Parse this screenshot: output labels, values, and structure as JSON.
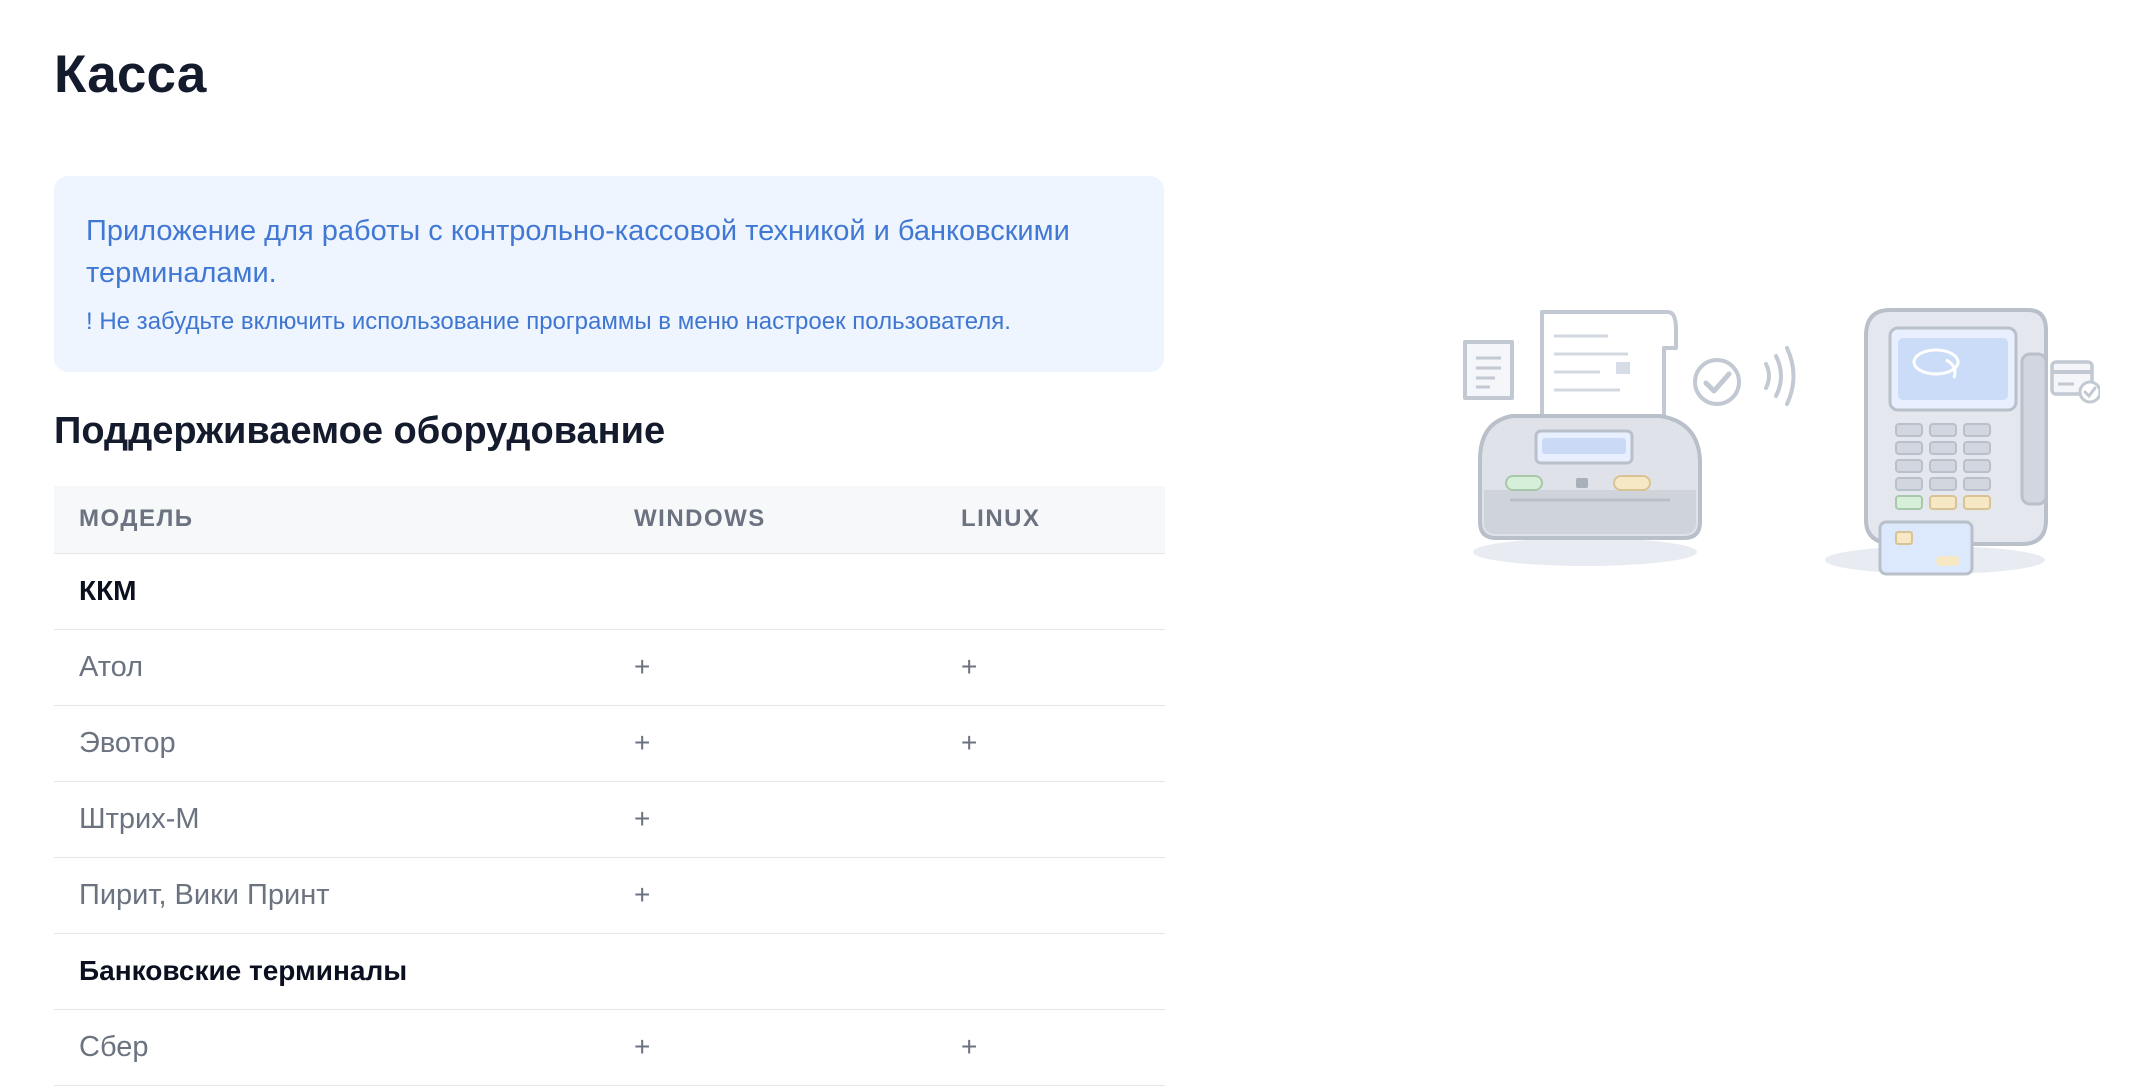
{
  "page": {
    "title": "Касса"
  },
  "info": {
    "description": "Приложение для работы с контрольно-кассовой техникой и банковскими терминалами.",
    "note": "! Не забудьте включить использование программы в меню настроек пользователя."
  },
  "hardware": {
    "title": "Поддерживаемое оборудование",
    "columns": [
      "Модель",
      "Windows",
      "Linux"
    ],
    "groups": [
      {
        "name": "ККМ",
        "rows": [
          {
            "model": "Атол",
            "windows": "+",
            "linux": "+"
          },
          {
            "model": "Эвотор",
            "windows": "+",
            "linux": "+"
          },
          {
            "model": "Штрих-М",
            "windows": "+",
            "linux": ""
          },
          {
            "model": "Пирит, Вики Принт",
            "windows": "+",
            "linux": ""
          }
        ]
      },
      {
        "name": "Банковские терминалы",
        "rows": [
          {
            "model": "Сбер",
            "windows": "+",
            "linux": "+"
          }
        ]
      }
    ]
  },
  "illustration": {
    "icons": [
      "receipt-icon",
      "cash-register-icon",
      "checkmark-icon",
      "contactless-icon",
      "payment-terminal-icon",
      "credit-card-icon"
    ]
  }
}
